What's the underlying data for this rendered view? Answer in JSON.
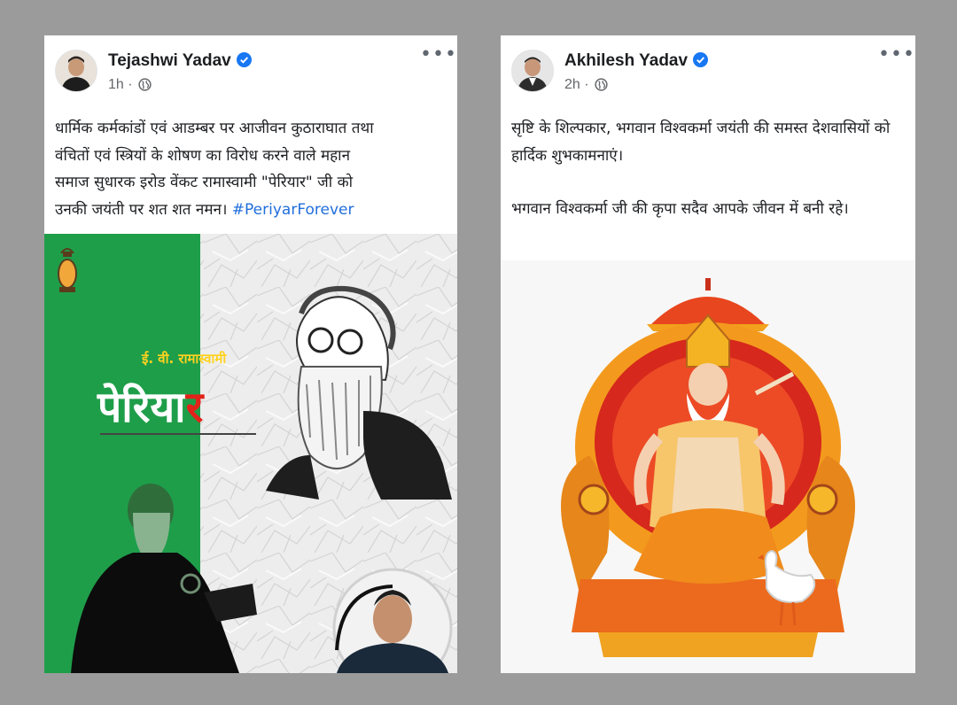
{
  "posts": [
    {
      "author": "Tejashwi Yadav",
      "time": "1h",
      "separator": "·",
      "more_label": "•••",
      "text_lines": [
        "धार्मिक कर्मकांडों एवं आडम्बर पर आजीवन कुठाराघात तथा",
        "वंचितों एवं स्त्रियों के शोषण का विरोध करने वाले महान",
        "समाज सुधारक इरोड वेंकट रामास्वामी \"पेरियार\" जी को",
        "उनकी जयंती पर शत शत नमन। "
      ],
      "hashtag": "#PeriyarForever",
      "image": {
        "subtitle": "ई. वी. रामास्वामी",
        "title_white": "पेरिया",
        "title_red": "र"
      }
    },
    {
      "author": "Akhilesh Yadav",
      "time": "2h",
      "separator": "·",
      "more_label": "•••",
      "paragraph1": "सृष्टि के शिल्पकार, भगवान विश्वकर्मा जयंती की समस्त देशवासियों को हार्दिक शुभकामनाएं।",
      "paragraph2": "भगवान विश्वकर्मा जी की कृपा सदैव आपके जीवन में बनी रहे।"
    }
  ],
  "colors": {
    "background": "#9b9b9b",
    "link_blue": "#216fdb",
    "verified_blue": "#1877f2",
    "periyar_green": "#1f9e4a",
    "periyar_red": "#e2231a"
  }
}
